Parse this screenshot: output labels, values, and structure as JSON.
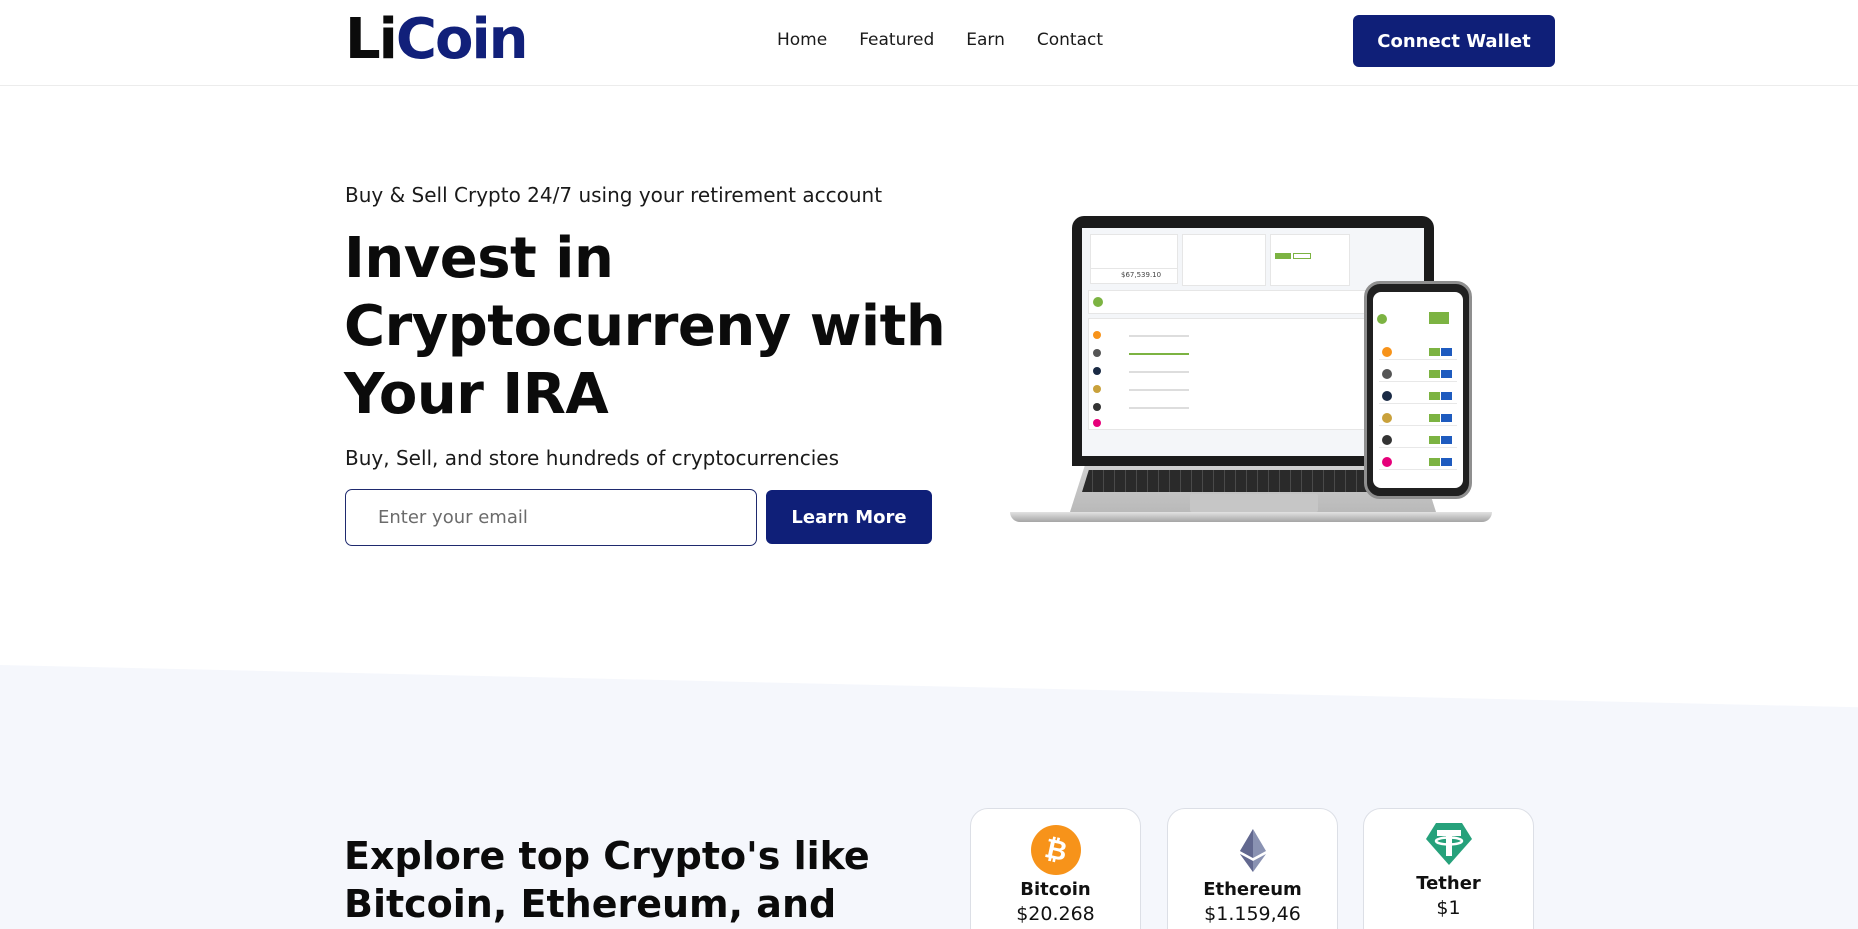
{
  "brand": {
    "logo_part1": "Li",
    "logo_part2": "Coin"
  },
  "nav": {
    "items": [
      {
        "label": "Home"
      },
      {
        "label": "Featured"
      },
      {
        "label": "Earn"
      },
      {
        "label": "Contact"
      }
    ],
    "connect_label": "Connect Wallet"
  },
  "hero": {
    "eyebrow": "Buy & Sell Crypto 24/7 using your retirement account",
    "title_lines": [
      "Invest in",
      "Cryptocurreny with",
      "Your IRA"
    ],
    "subtitle": "Buy, Sell, and store hundreds of cryptocurrencies",
    "email_placeholder": "Enter your email",
    "learn_more_label": "Learn More"
  },
  "mockup": {
    "laptop_balance": "$67,539.10"
  },
  "explore": {
    "title_lines": [
      "Explore top Crypto's like",
      "Bitcoin, Ethereum, and"
    ],
    "coins": [
      {
        "name": "Bitcoin",
        "price": "$20.268",
        "icon": "bitcoin-icon",
        "color": "#f7931a"
      },
      {
        "name": "Ethereum",
        "price": "$1.159,46",
        "icon": "ethereum-icon",
        "color": "#627eea"
      },
      {
        "name": "Tether",
        "price": "$1",
        "icon": "tether-icon",
        "color": "#26a17b"
      }
    ]
  },
  "colors": {
    "primary": "#0f1f78",
    "band": "#f5f7fc"
  }
}
